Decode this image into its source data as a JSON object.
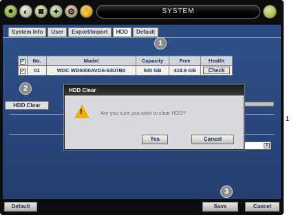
{
  "toolbar": {
    "title": "SYSTEM"
  },
  "tabs": [
    {
      "label": "System Info"
    },
    {
      "label": "User"
    },
    {
      "label": "Export/Import"
    },
    {
      "label": "HDD"
    },
    {
      "label": "Default"
    }
  ],
  "table": {
    "headers": [
      "No.",
      "Model",
      "Capacity",
      "Free",
      "Health"
    ],
    "rows": [
      {
        "checked": true,
        "no": "01",
        "model": "WDC WD5000AVDS-63U7B0",
        "capacity": "500 GB",
        "free": "418.6 GB",
        "health_button": "Check"
      }
    ]
  },
  "hdd_clear_button": "HDD Clear",
  "bottom": {
    "default": "Default",
    "save": "Save",
    "cancel": "Cancel"
  },
  "dialog": {
    "title": "HDD Clear",
    "message": "Are you sure you want to clear HDD?",
    "yes": "Yes",
    "cancel": "Cancel"
  },
  "badges": [
    "1",
    "2",
    "3"
  ],
  "side_label": "1",
  "colors": {
    "panel": "#2a4b82",
    "toolbar": "#0d0d0d",
    "warning": "#f0b000"
  }
}
